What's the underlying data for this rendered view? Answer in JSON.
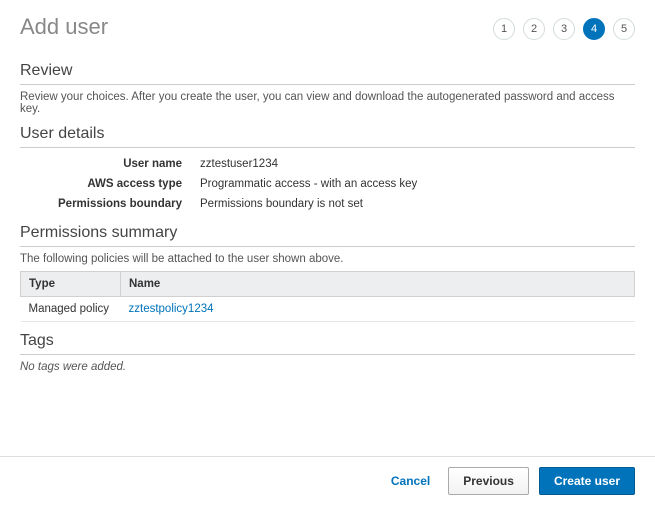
{
  "page_title": "Add user",
  "stepper": {
    "steps": [
      "1",
      "2",
      "3",
      "4",
      "5"
    ],
    "active_index": 3
  },
  "review": {
    "title": "Review",
    "description": "Review your choices. After you create the user, you can view and download the autogenerated password and access key."
  },
  "user_details": {
    "title": "User details",
    "rows": [
      {
        "label": "User name",
        "value": "zztestuser1234"
      },
      {
        "label": "AWS access type",
        "value": "Programmatic access - with an access key"
      },
      {
        "label": "Permissions boundary",
        "value": "Permissions boundary is not set"
      }
    ]
  },
  "permissions_summary": {
    "title": "Permissions summary",
    "description": "The following policies will be attached to the user shown above.",
    "columns": {
      "type": "Type",
      "name": "Name"
    },
    "rows": [
      {
        "type": "Managed policy",
        "name": "zztestpolicy1234"
      }
    ]
  },
  "tags": {
    "title": "Tags",
    "empty_text": "No tags were added."
  },
  "footer": {
    "cancel": "Cancel",
    "previous": "Previous",
    "create_user": "Create user"
  }
}
